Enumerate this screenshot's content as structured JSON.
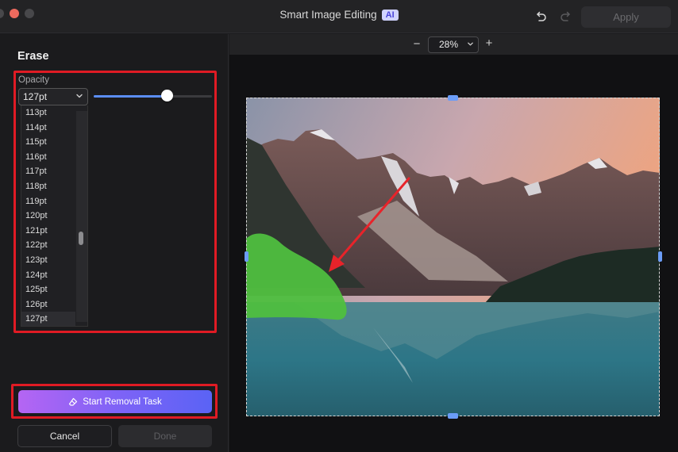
{
  "window": {
    "title": "Smart Image Editing",
    "ai_badge": "AI",
    "apply_label": "Apply"
  },
  "panel": {
    "title": "Erase",
    "opacity_label": "Opacity",
    "brush_size": "127pt",
    "slider_fraction": 0.62,
    "sizes": [
      "113pt",
      "114pt",
      "115pt",
      "116pt",
      "117pt",
      "118pt",
      "119pt",
      "120pt",
      "121pt",
      "122pt",
      "123pt",
      "124pt",
      "125pt",
      "126pt",
      "127pt"
    ],
    "selected_size": "127pt",
    "removal_label": "Start Removal Task",
    "cancel_label": "Cancel",
    "done_label": "Done"
  },
  "canvas": {
    "zoom": "28%",
    "zoom_minus": "−",
    "zoom_plus": "+"
  },
  "colors": {
    "accent_gradient_start": "#b565f3",
    "accent_gradient_end": "#5a63f5",
    "highlight": "#e01b24",
    "brush_mask": "#4fbf3f",
    "slider": "#5b8ef6"
  },
  "icons": {
    "undo": "undo-icon",
    "redo": "redo-icon",
    "eraser": "eraser-icon",
    "chevron": "chevron-down-icon"
  }
}
